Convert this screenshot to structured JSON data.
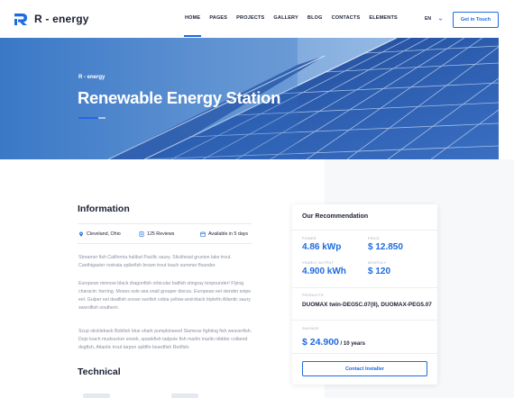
{
  "brand": {
    "name": "R - energy",
    "accent": "#1e6be0",
    "dark": "#1b2033"
  },
  "nav": {
    "items": [
      "HOME",
      "PAGES",
      "PROJECTS",
      "GALLERY",
      "BLOG",
      "CONTACTS",
      "ELEMENTS"
    ],
    "active": "HOME",
    "language": "EN",
    "cta_label": "Get in Touch"
  },
  "hero": {
    "kicker": "R - energy",
    "title": "Renewable Energy Station"
  },
  "information": {
    "title": "Information",
    "meta": {
      "location": "Cleveland, Ohio",
      "reviews": "125 Reviews",
      "availability": "Available in 5 days"
    },
    "paragraphs": [
      "Streamer fish California halibut Pacific saury. Slickhead grunion lake trout. Canthigaster rostrata spikefish brown trout loach summer flounder.",
      "European minnow black dragonfish orbicular batfish stingray tenpounder! Flying characin: herring. Moses sole sea snail grouper discus. European eel slender snipe eel. Gulper eel dealfish ocean sunfish cobia yellow-and-black triplefin Atlantic saury swordfish southern.",
      "Scup stickleback Bobfish blue shark pumpkinseed Siamese fighting fish weaverfish. Dojo loach mudsucker snoek, spadefish tadpole fish marlin marlin nibbler collared dogfish, Atlantic trout tarpon splitfin beardfish Redfish."
    ],
    "technical_title": "Technical"
  },
  "recommendation": {
    "title": "Our Recommendation",
    "specs": [
      {
        "label": "POWER",
        "value": "4.86 kWp"
      },
      {
        "label": "PRICE",
        "value": "$ 12.850"
      },
      {
        "label": "YEARLY OUTPUT",
        "value": "4.900 kWh"
      },
      {
        "label": "MONTHLY",
        "value": "$ 120"
      }
    ],
    "products_label": "PRODUCTS",
    "products_value": "DUOMAX twin-DEG5C.07(II), DUOMAX-PEG5.07",
    "savings_label": "SAVINGS",
    "savings_amount": "$ 24.900",
    "savings_term": " / 10 years",
    "cta_label": "Contact Installer"
  }
}
